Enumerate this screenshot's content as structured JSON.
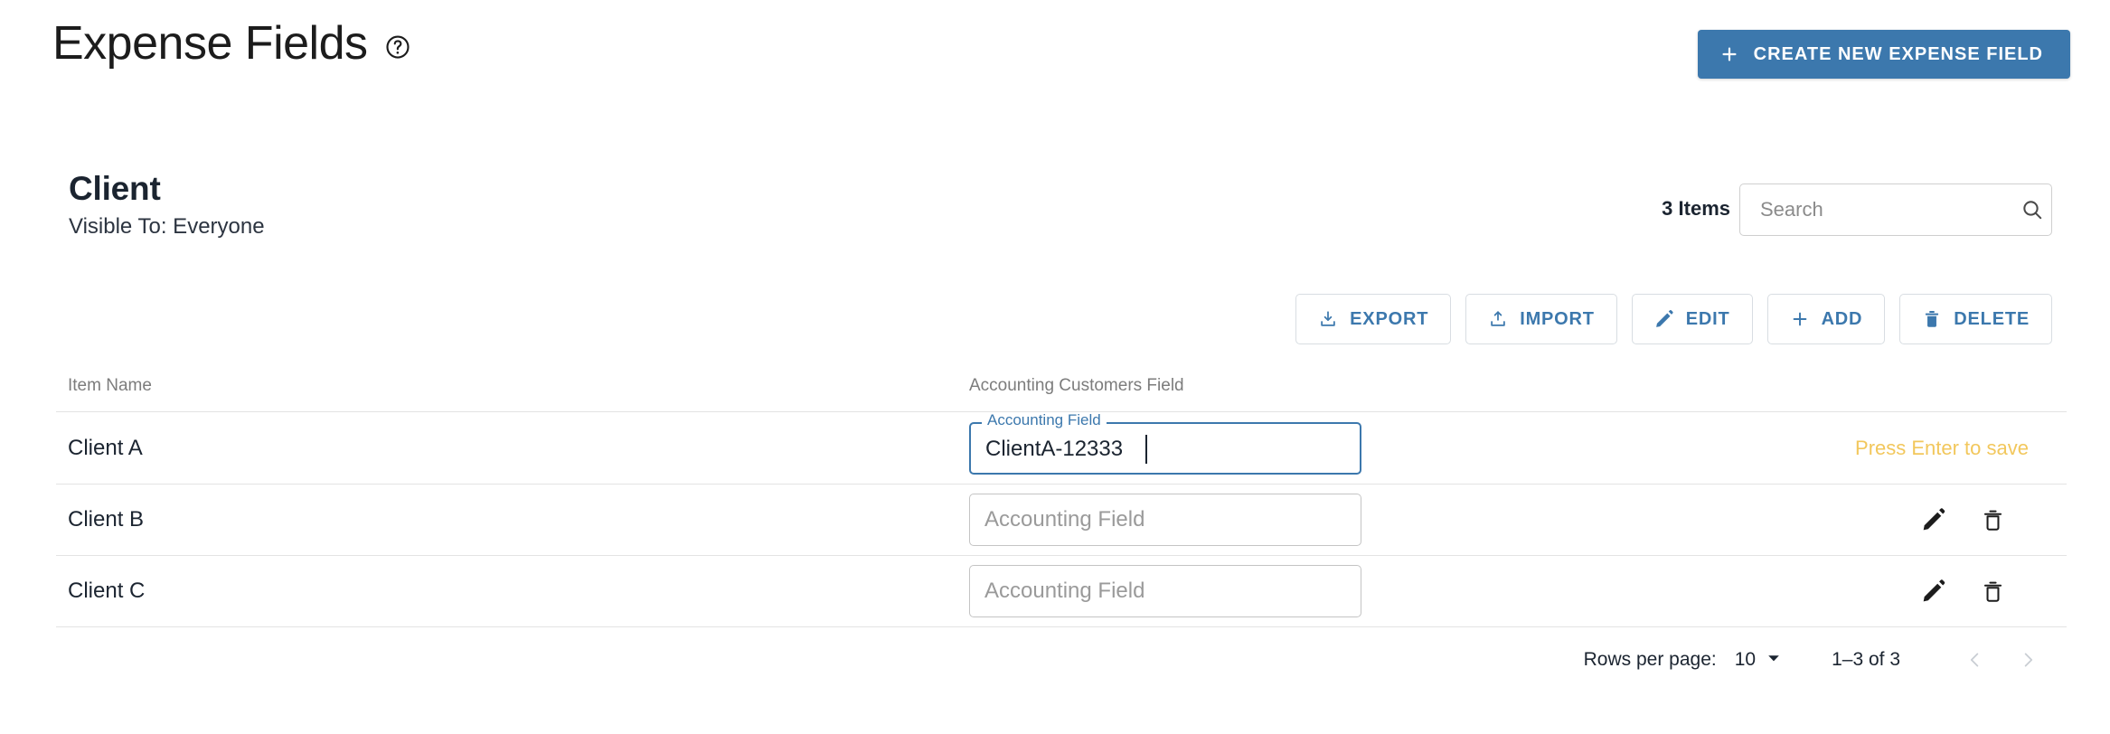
{
  "header": {
    "title": "Expense Fields",
    "help_icon": "help-circle-icon",
    "create_button": {
      "label": "CREATE NEW EXPENSE FIELD",
      "icon": "plus-icon",
      "bg_color": "#3c78ad",
      "text_color": "#ffffff"
    }
  },
  "section": {
    "title": "Client",
    "subtitle": "Visible To: Everyone",
    "items_count": "3 Items"
  },
  "search": {
    "placeholder": "Search",
    "value": "",
    "icon": "search-icon"
  },
  "actions": [
    {
      "label": "EXPORT",
      "icon": "download-icon"
    },
    {
      "label": "IMPORT",
      "icon": "upload-icon"
    },
    {
      "label": "EDIT",
      "icon": "pencil-icon"
    },
    {
      "label": "ADD",
      "icon": "plus-icon"
    },
    {
      "label": "DELETE",
      "icon": "trash-icon"
    }
  ],
  "table": {
    "columns": [
      "Item Name",
      "Accounting Customers Field"
    ],
    "rows": [
      {
        "name": "Client A",
        "field_label": "Accounting Field",
        "field_value": "ClientA-12333",
        "field_placeholder": "",
        "focused": true,
        "hint": "Press Enter to save",
        "hint_color": "#f2c75c"
      },
      {
        "name": "Client B",
        "field_label": "",
        "field_value": "",
        "field_placeholder": "Accounting Field",
        "focused": false,
        "hint": ""
      },
      {
        "name": "Client C",
        "field_label": "",
        "field_value": "",
        "field_placeholder": "Accounting Field",
        "focused": false,
        "hint": ""
      }
    ],
    "row_icons": {
      "edit": "pencil-icon",
      "delete": "trash-icon"
    }
  },
  "pagination": {
    "rows_per_page_label": "Rows per page:",
    "rows_per_page_value": "10",
    "range_label": "1–3 of 3",
    "prev_icon": "chevron-left-icon",
    "next_icon": "chevron-right-icon"
  },
  "theme": {
    "accent": "#3c78ad",
    "divider": "#e3e3e3",
    "muted_text": "#7c7c7c"
  }
}
